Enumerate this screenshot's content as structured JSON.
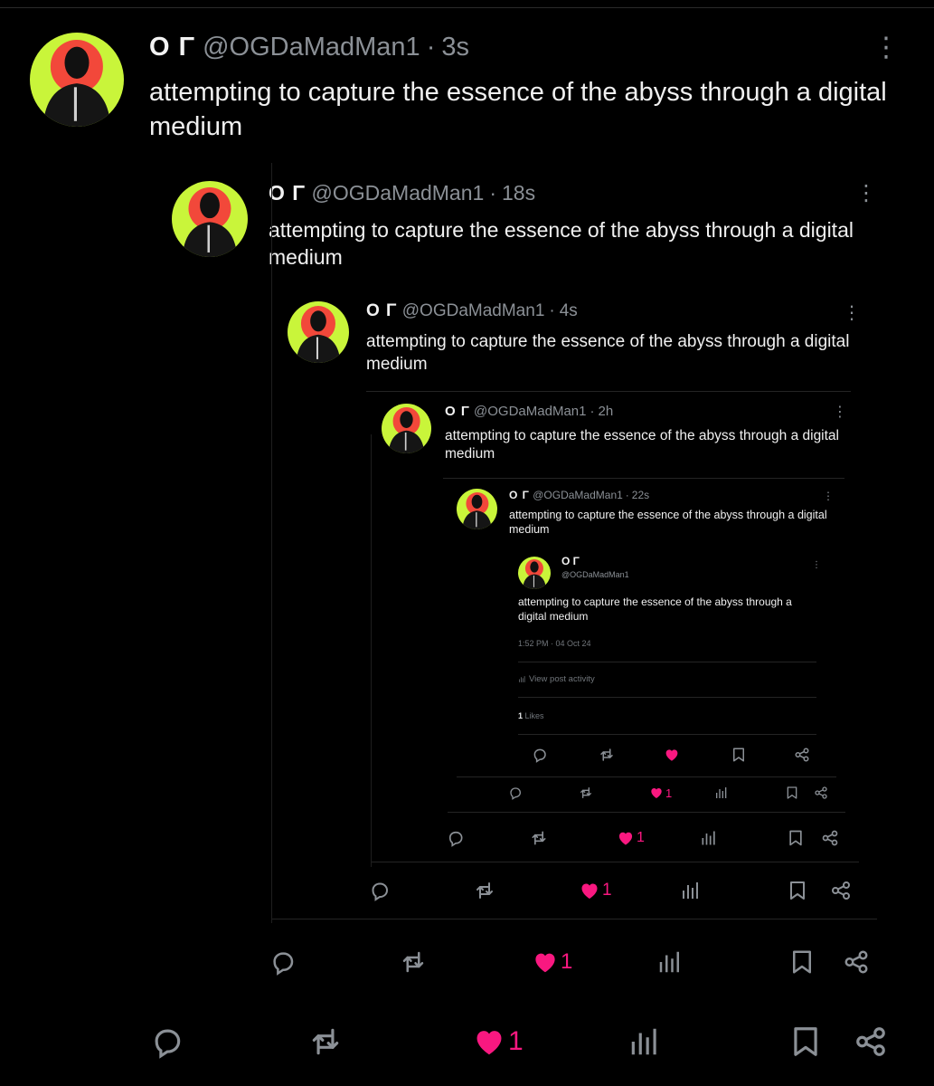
{
  "posts": [
    {
      "name": "O Γ",
      "handle": "@OGDaMadMan1",
      "time": "3s",
      "text": "attempting to capture the essence of the abyss through a digital medium"
    },
    {
      "name": "O Γ",
      "handle": "@OGDaMadMan1",
      "time": "18s",
      "text": "attempting to capture the essence of the abyss through a digital medium"
    },
    {
      "name": "O Γ",
      "handle": "@OGDaMadMan1",
      "time": "4s",
      "text": "attempting to capture the essence of the abyss through a digital medium"
    },
    {
      "name": "O Γ",
      "handle": "@OGDaMadMan1",
      "time": "2h",
      "text": "attempting to capture the essence of the abyss through a digital medium"
    },
    {
      "name": "O Γ",
      "handle": "@OGDaMadMan1",
      "time": "22s",
      "text": "attempting to capture the essence of the abyss through a digital medium"
    }
  ],
  "innermost": {
    "name": "O Γ",
    "handle": "@OGDaMadMan1",
    "text": "attempting to capture the essence of the abyss through a digital medium",
    "timestamp": "1:52 PM · 04 Oct 24",
    "view_activity": "View post activity",
    "likes_count": "1",
    "likes_label": "Likes"
  },
  "actions": {
    "like_count": "1",
    "dot_sep": "·",
    "more": "⋮"
  },
  "colors": {
    "background": "#000000",
    "text": "#e7e9ea",
    "muted": "#71767b",
    "like": "#f91880",
    "avatar_bg": "#c9f53a",
    "avatar_sun": "#f2483a"
  },
  "icons": [
    "reply-icon",
    "repost-icon",
    "heart-icon",
    "views-icon",
    "bookmark-icon",
    "share-icon",
    "more-icon"
  ]
}
